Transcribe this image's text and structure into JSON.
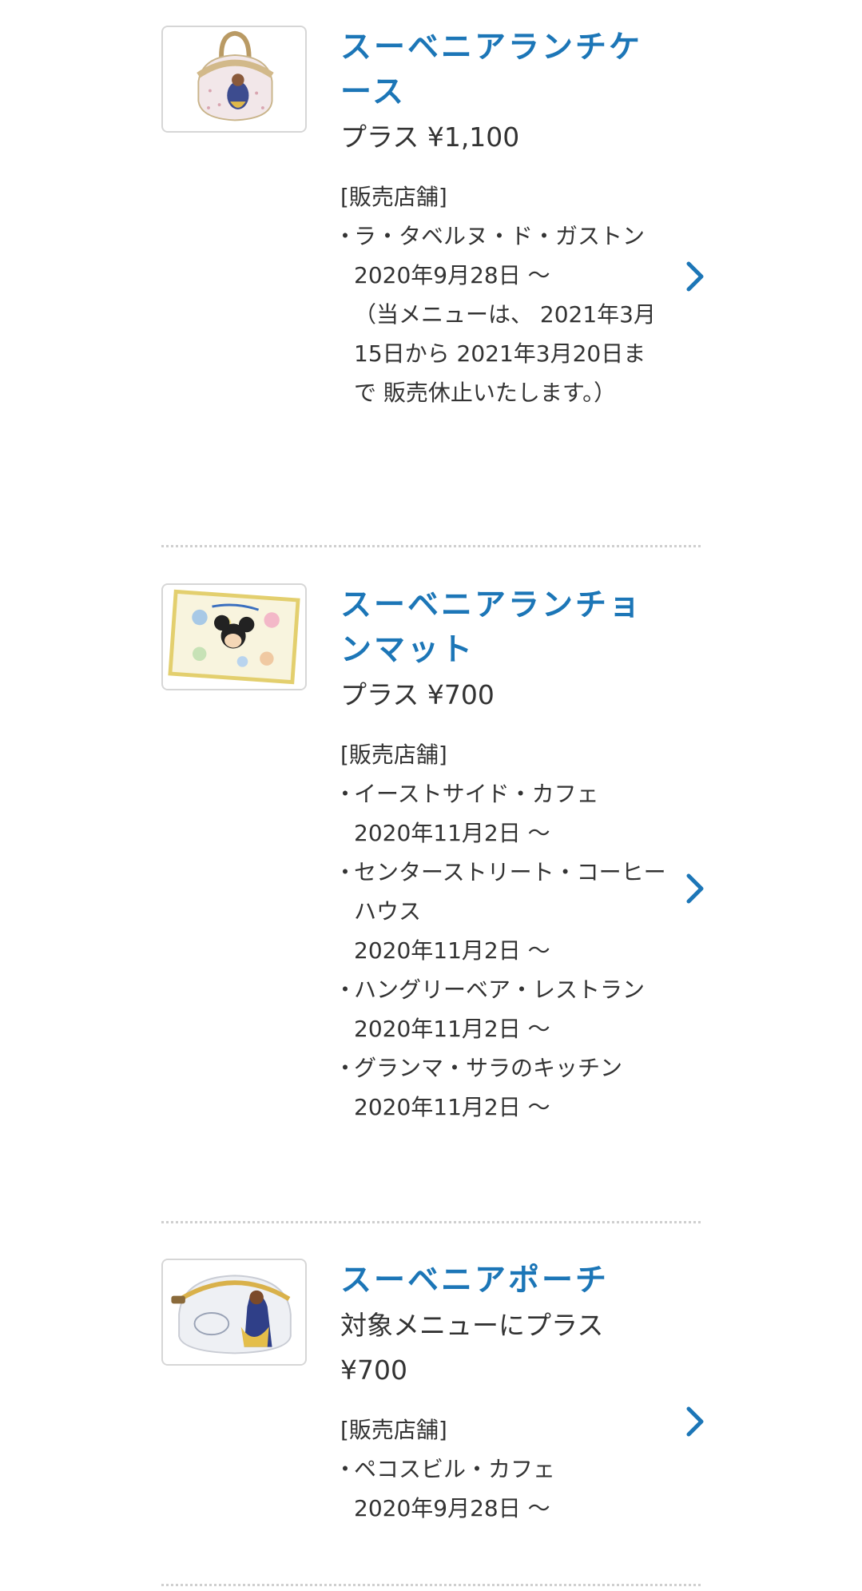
{
  "products": [
    {
      "title": "スーベニアランチケース",
      "price": "プラス ¥1,100",
      "stores_heading": "[販売店舗]",
      "stores": [
        {
          "name": "ラ・タベルヌ・ド・ガストン",
          "date": "2020年9月28日 〜",
          "note": "（当メニューは、 2021年3月15日から 2021年3月20日まで 販売休止いたします。）"
        }
      ],
      "thumbnail_icon": "lunch-case-image"
    },
    {
      "title": "スーベニアランチョンマット",
      "price": "プラス ¥700",
      "stores_heading": "[販売店舗]",
      "stores": [
        {
          "name": "イーストサイド・カフェ",
          "date": "2020年11月2日 〜"
        },
        {
          "name": "センターストリート・コーヒーハウス",
          "date": "2020年11月2日 〜"
        },
        {
          "name": "ハングリーベア・レストラン",
          "date": "2020年11月2日 〜"
        },
        {
          "name": "グランマ・サラのキッチン",
          "date": "2020年11月2日 〜"
        }
      ],
      "thumbnail_icon": "luncheon-mat-image"
    },
    {
      "title": "スーベニアポーチ",
      "price": "対象メニューにプラス ¥700",
      "stores_heading": "[販売店舗]",
      "stores": [
        {
          "name": "ペコスビル・カフェ",
          "date": "2020年9月28日 〜"
        }
      ],
      "thumbnail_icon": "pouch-image"
    }
  ],
  "colors": {
    "title": "#1c76b7",
    "text": "#333333",
    "chevron": "#1c76b7",
    "divider": "#cfcfcf",
    "thumb_border": "#d6d6d6"
  },
  "icons": {
    "chevron": "chevron-right-icon"
  }
}
